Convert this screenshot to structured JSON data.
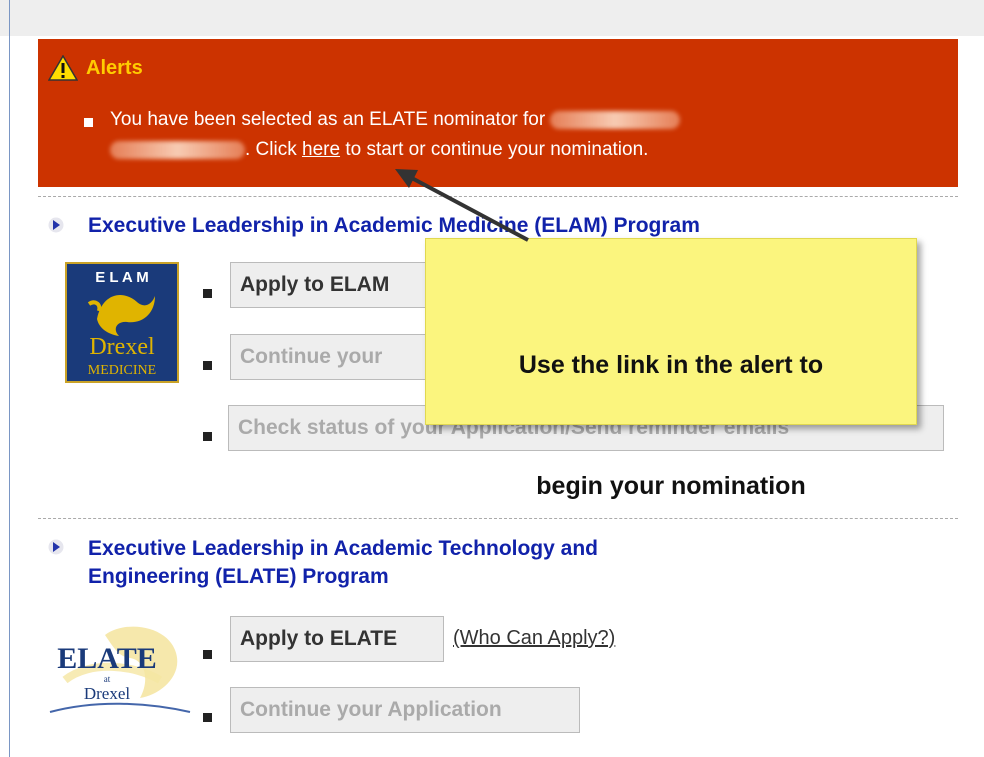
{
  "alert": {
    "title": "Alerts",
    "text_before": "You have been selected as an ELATE nominator for",
    "text_mid": ". Click",
    "link": "here",
    "text_after": "to start or continue your nomination."
  },
  "elam": {
    "title": "Executive Leadership in Academic Medicine (ELAM) Program",
    "logo_text": [
      "E L A M",
      "Drexel",
      "MEDICINE"
    ],
    "buttons": [
      "Apply to ELAM",
      "Continue your",
      "Check status of your Application/Send reminder emails"
    ]
  },
  "elate": {
    "title_line1": "Executive Leadership in Academic Technology and",
    "title_line2": "Engineering (ELATE) Program",
    "logo_text": [
      "ELATE",
      "at",
      "Drexel"
    ],
    "apply_button": "Apply to ELATE",
    "who_can_apply": "(Who Can Apply?)",
    "continue_button": "Continue your Application"
  },
  "callout": {
    "line1": "Use the link in the alert to",
    "line2": "begin your nomination"
  },
  "colors": {
    "alert_bg": "#cc3300",
    "alert_title": "#ffcc00",
    "section_title": "#1122aa",
    "callout_bg": "#fbf57e"
  }
}
